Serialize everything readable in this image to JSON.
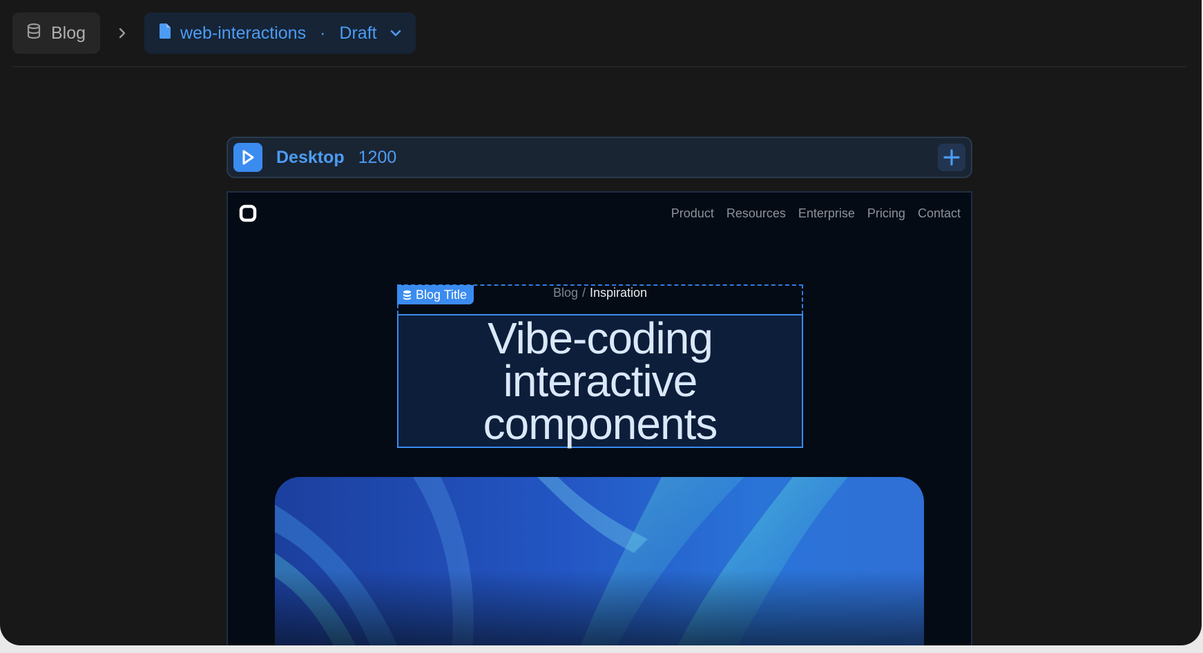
{
  "breadcrumb": {
    "root_label": "Blog",
    "file_label": "web-interactions",
    "separator_dot": "·",
    "status": "Draft"
  },
  "breakpoint": {
    "name": "Desktop",
    "width": "1200"
  },
  "site": {
    "nav": [
      "Product",
      "Resources",
      "Enterprise",
      "Pricing",
      "Contact"
    ]
  },
  "selection": {
    "tag_label": "Blog Title"
  },
  "post": {
    "crumb_parent": "Blog",
    "crumb_sep": "/",
    "crumb_current": "Inspiration",
    "title_lines": [
      "Vibe-coding",
      "interactive",
      "components"
    ]
  },
  "colors": {
    "accent": "#3b8cf0",
    "accent_text": "#4c9cf5",
    "app_bg": "#181818",
    "canvas_bg": "#050b14"
  },
  "icons": {
    "root": "database-icon",
    "file": "file-icon",
    "chevron": "chevron-right-icon",
    "dropdown": "chevron-down-icon",
    "breakpoint": "play-icon",
    "add": "plus-icon"
  }
}
